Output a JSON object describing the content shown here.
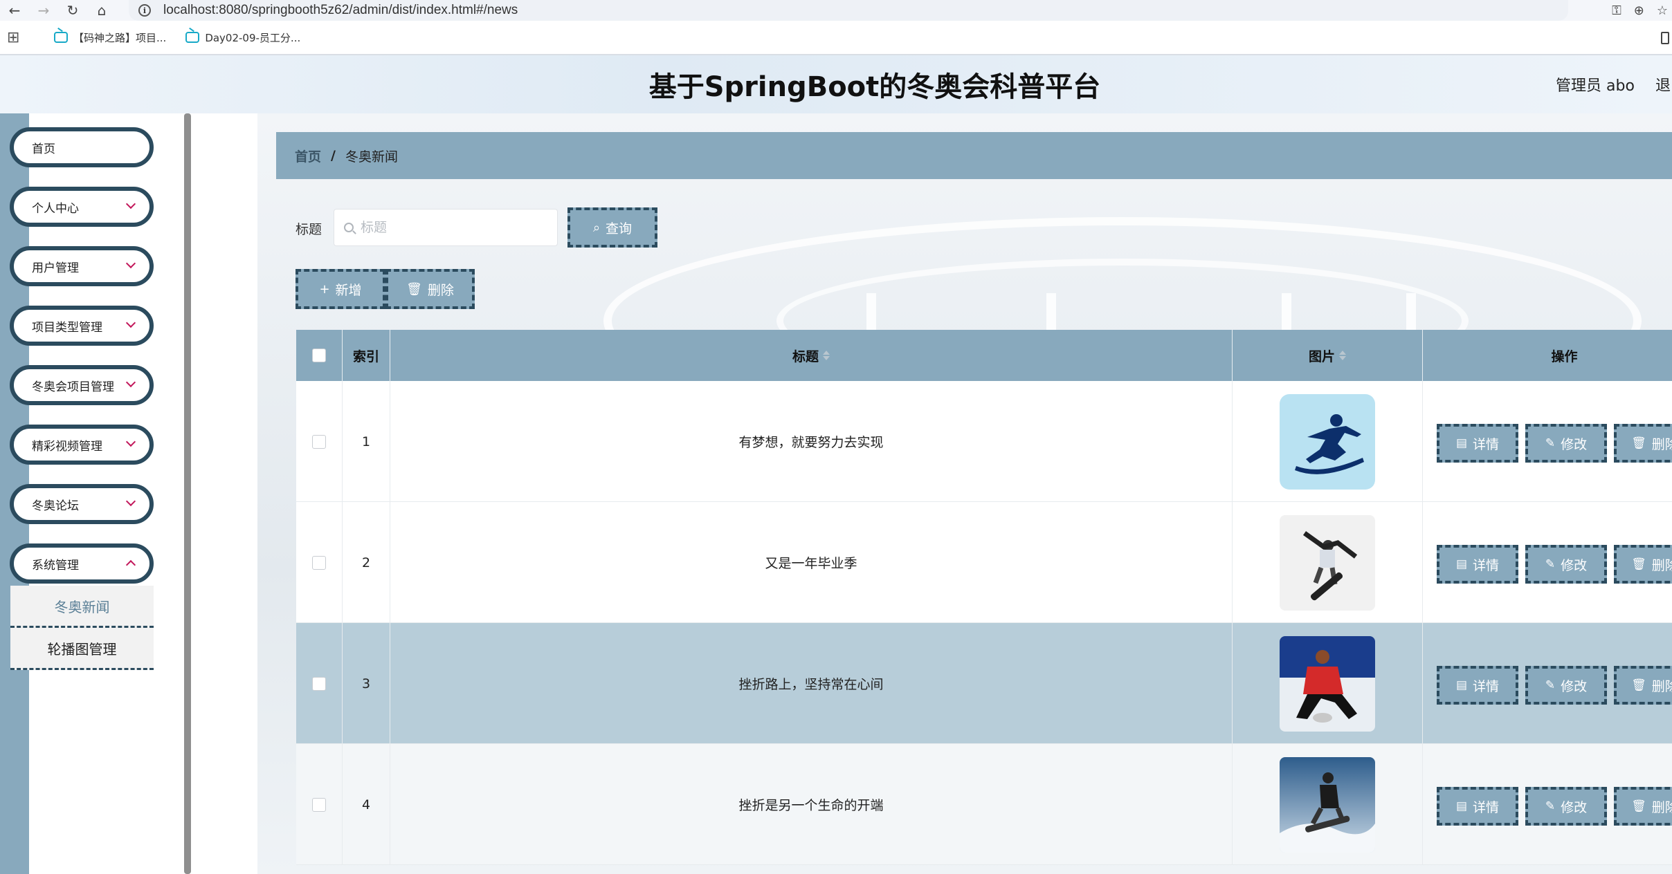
{
  "browser": {
    "url": "localhost:8080/springbooth5z62/admin/dist/index.html#/news",
    "bookmarks": [
      "【码神之路】项目...",
      "Day02-09-员工分..."
    ]
  },
  "header": {
    "title": "基于SpringBoot的冬奥会科普平台",
    "user": "管理员 abo",
    "logout": "退"
  },
  "sidebar": {
    "items": [
      {
        "label": "首页",
        "has_arrow": false
      },
      {
        "label": "个人中心",
        "has_arrow": true
      },
      {
        "label": "用户管理",
        "has_arrow": true
      },
      {
        "label": "项目类型管理",
        "has_arrow": true
      },
      {
        "label": "冬奥会项目管理",
        "has_arrow": true
      },
      {
        "label": "精彩视频管理",
        "has_arrow": true
      },
      {
        "label": "冬奥论坛",
        "has_arrow": true
      },
      {
        "label": "系统管理",
        "has_arrow": true
      }
    ],
    "submenu": [
      "冬奥新闻",
      "轮播图管理"
    ]
  },
  "breadcrumb": {
    "home": "首页",
    "separator": "/",
    "current": "冬奥新闻"
  },
  "search": {
    "label": "标题",
    "placeholder": "标题",
    "query_button": "查询"
  },
  "actions": {
    "add": "新增",
    "delete": "删除"
  },
  "table": {
    "headers": {
      "index": "索引",
      "title": "标题",
      "image": "图片",
      "ops": "操作"
    },
    "rows": [
      {
        "index": "1",
        "title": "有梦想，就要努力去实现"
      },
      {
        "index": "2",
        "title": "又是一年毕业季"
      },
      {
        "index": "3",
        "title": "挫折路上，坚持常在心间"
      },
      {
        "index": "4",
        "title": "挫折是另一个生命的开端"
      }
    ],
    "row_buttons": {
      "detail": "详情",
      "edit": "修改",
      "remove": "删除"
    }
  },
  "colors": {
    "accent": "#88a9bd",
    "dark": "#2b4b5e",
    "highlight_row": "#b7cdd9"
  }
}
